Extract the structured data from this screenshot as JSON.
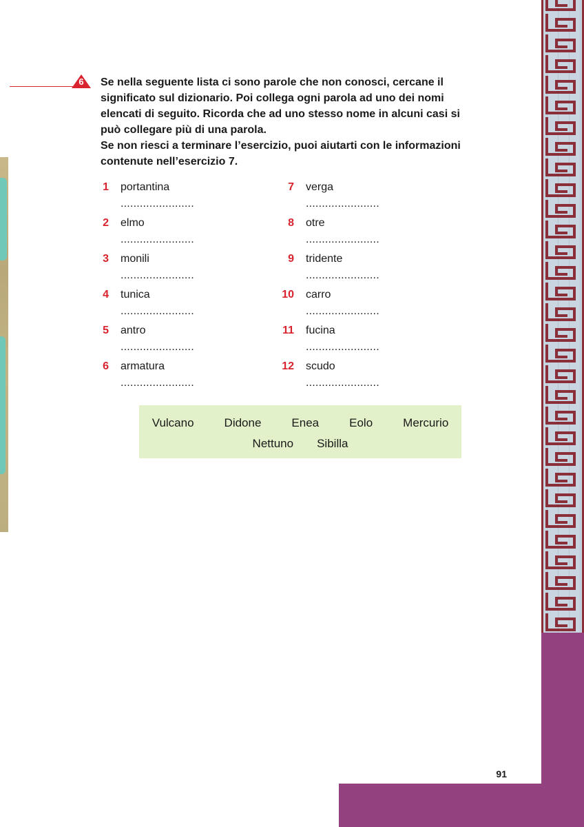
{
  "exercise": {
    "number": "6",
    "instructions": [
      "Se nella seguente lista ci sono parole che non conosci, cercane il",
      "significato sul dizionario. Poi collega ogni parola ad uno dei nomi",
      "elencati di seguito. Ricorda che ad uno stesso nome in alcuni casi si",
      "può collegare più di una parola.",
      "Se non riesci a terminare l’esercizio, puoi aiutarti con le informazioni",
      "contenute nell’esercizio 7."
    ]
  },
  "words_left": [
    {
      "num": "1",
      "word": "portantina",
      "blank": "......................."
    },
    {
      "num": "2",
      "word": "elmo",
      "blank": "......................."
    },
    {
      "num": "3",
      "word": "monili",
      "blank": "......................."
    },
    {
      "num": "4",
      "word": "tunica",
      "blank": "......................."
    },
    {
      "num": "5",
      "word": "antro",
      "blank": "......................."
    },
    {
      "num": "6",
      "word": "armatura",
      "blank": "......................."
    }
  ],
  "words_right": [
    {
      "num": "7",
      "word": "verga",
      "blank": "......................."
    },
    {
      "num": "8",
      "word": "otre",
      "blank": "......................."
    },
    {
      "num": "9",
      "word": "tridente",
      "blank": "......................."
    },
    {
      "num": "10",
      "word": "carro",
      "blank": "......................."
    },
    {
      "num": "11",
      "word": "fucina",
      "blank": "......................."
    },
    {
      "num": "12",
      "word": "scudo",
      "blank": "......................."
    }
  ],
  "names": {
    "row1": [
      "Vulcano",
      "Didone",
      "Enea",
      "Eolo",
      "Mercurio"
    ],
    "row2": [
      "Nettuno",
      "Sibilla"
    ]
  },
  "page_number": "91",
  "colors": {
    "accent_red": "#d9232e",
    "purple": "#93417f",
    "names_box_bg": "#e2f1c9",
    "greek_key": "#8a2f3a"
  }
}
